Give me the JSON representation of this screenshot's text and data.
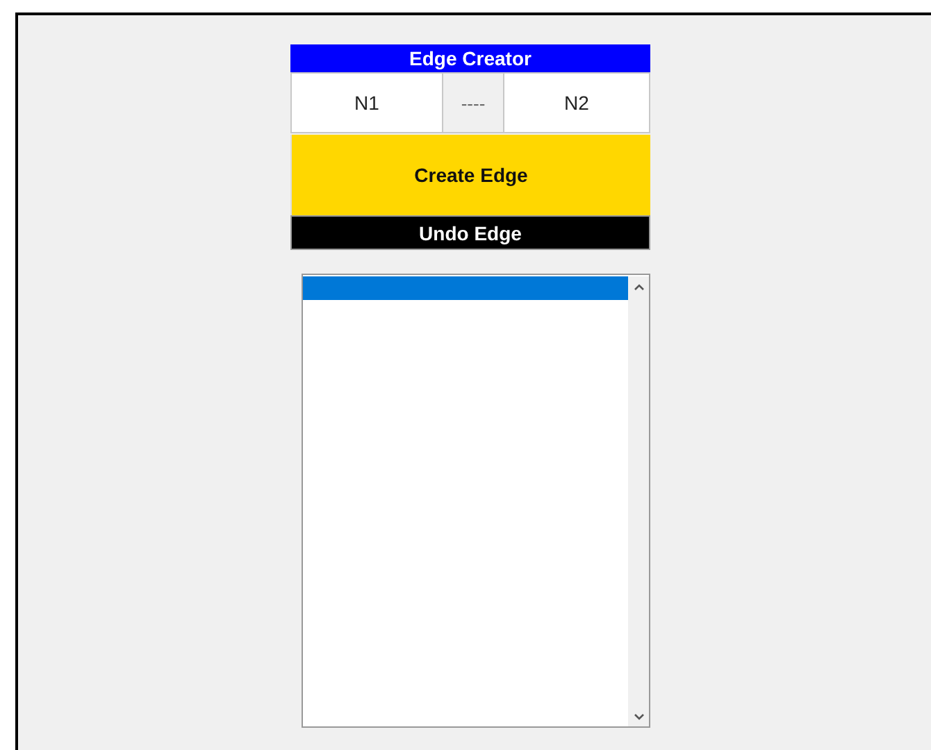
{
  "panel": {
    "title": "Edge Creator",
    "from_field": {
      "value": "N1"
    },
    "separator": "----",
    "to_field": {
      "value": "N2"
    },
    "create_button": "Create Edge",
    "undo_button": "Undo Edge"
  },
  "listbox": {
    "items": [
      {
        "selected": true
      }
    ]
  }
}
